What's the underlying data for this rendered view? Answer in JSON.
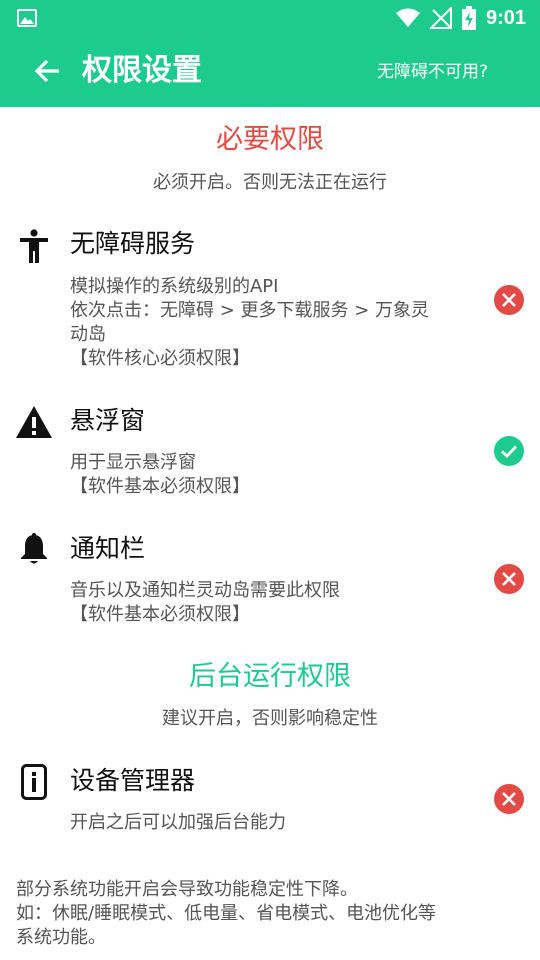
{
  "status_bar": {
    "time": "9:01"
  },
  "toolbar": {
    "title": "权限设置",
    "action": "无障碍不可用?"
  },
  "required": {
    "title": "必要权限",
    "subtitle": "必须开启。否则无法正在运行",
    "items": [
      {
        "title": "无障碍服务",
        "desc": [
          "模拟操作的系统级别的API",
          "依次点击：无障碍 > 更多下载服务 > 万象灵",
          "动岛",
          "【软件核心必须权限】"
        ],
        "status": "disabled"
      },
      {
        "title": "悬浮窗",
        "desc": [
          "用于显示悬浮窗",
          "【软件基本必须权限】"
        ],
        "status": "enabled"
      },
      {
        "title": "通知栏",
        "desc": [
          "音乐以及通知栏灵动岛需要此权限",
          "【软件基本必须权限】"
        ],
        "status": "disabled"
      }
    ]
  },
  "background": {
    "title": "后台运行权限",
    "subtitle": "建议开启，否则影响稳定性",
    "items": [
      {
        "title": "设备管理器",
        "desc": [
          "开启之后可以加强后台能力"
        ],
        "status": "disabled"
      }
    ]
  },
  "footnote": [
    "部分系统功能开启会导致功能稳定性下降。",
    "如：休眠/睡眠模式、低电量、省电模式、电池优化等",
    "系统功能。"
  ],
  "colors": {
    "accent": "#1ecb8e",
    "error": "#e24b45"
  },
  "icons": {
    "gallery": "gallery-icon",
    "wifi": "wifi-icon",
    "signal": "no-signal-icon",
    "battery": "battery-charging-icon",
    "back": "arrow-left-icon",
    "accessibility": "accessibility-icon",
    "overlay": "warning-icon",
    "notification": "bell-icon",
    "device_admin": "device-info-icon",
    "disabled": "close-icon",
    "enabled": "check-icon"
  }
}
